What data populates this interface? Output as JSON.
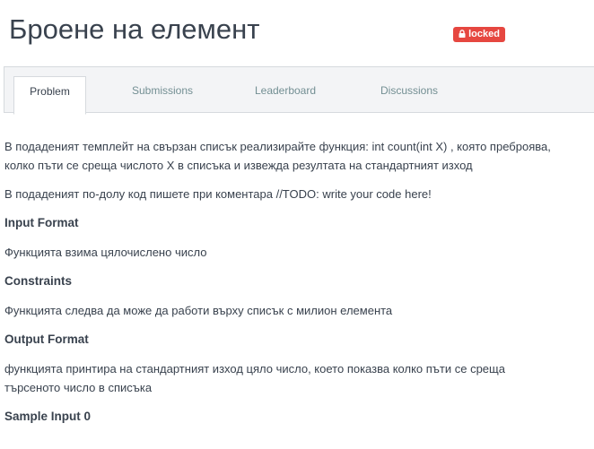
{
  "header": {
    "title": "Броене на елемент",
    "badge": "locked"
  },
  "tabs": [
    {
      "label": "Problem",
      "active": true
    },
    {
      "label": "Submissions",
      "active": false
    },
    {
      "label": "Leaderboard",
      "active": false
    },
    {
      "label": "Discussions",
      "active": false
    }
  ],
  "problem": {
    "intro": "В подаденият темплейт на свързан списък реализирайте функция: int count(int X) , която преброява, колко пъти се среща числото X в списъка и извежда резултата на стандартният изход",
    "todo_note": "В подаденият по-долу код пишете при коментара //TODO: write your code here!",
    "input_format_heading": "Input Format",
    "input_format_text": "Функцията взима цялочислено число",
    "constraints_heading": "Constraints",
    "constraints_text": "Функцията следва да може да работи върху списък с милион елемента",
    "output_format_heading": "Output Format",
    "output_format_text": "функцията принтира на стандартният изход цяло число, което показва колко пъти се среща търсеното число в списъка",
    "sample_input_heading": "Sample Input 0"
  },
  "colors": {
    "badge_bg": "#e64740",
    "text": "#39424e",
    "tab_inactive": "#738f93",
    "tabbar_bg": "#f3f4f6",
    "border": "#d6dade"
  },
  "icons": {
    "badge_icon": "lock-icon"
  }
}
